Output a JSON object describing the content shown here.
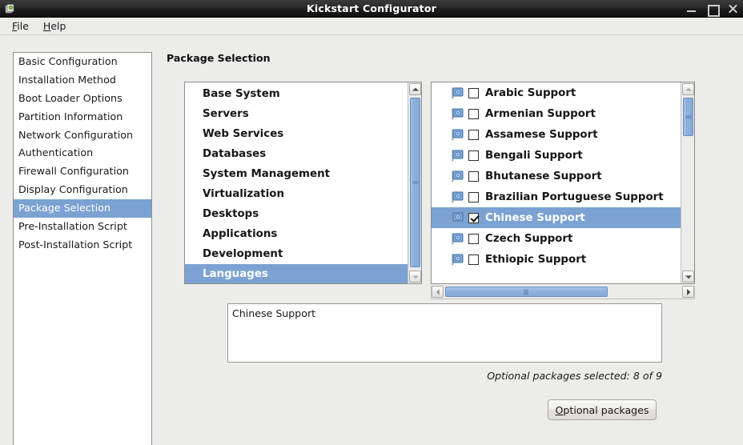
{
  "window": {
    "title": "Kickstart Configurator",
    "app_icon": "app-icon",
    "controls": {
      "minimize": "minimize",
      "maximize": "maximize",
      "close": "close"
    }
  },
  "menubar": {
    "items": [
      {
        "label": "File",
        "mnemonic": "F"
      },
      {
        "label": "Help",
        "mnemonic": "H"
      }
    ]
  },
  "sidebar": {
    "items": [
      {
        "label": "Basic Configuration",
        "selected": false
      },
      {
        "label": "Installation Method",
        "selected": false
      },
      {
        "label": "Boot Loader Options",
        "selected": false
      },
      {
        "label": "Partition Information",
        "selected": false
      },
      {
        "label": "Network Configuration",
        "selected": false
      },
      {
        "label": "Authentication",
        "selected": false
      },
      {
        "label": "Firewall Configuration",
        "selected": false
      },
      {
        "label": "Display Configuration",
        "selected": false
      },
      {
        "label": "Package Selection",
        "selected": true
      },
      {
        "label": "Pre-Installation Script",
        "selected": false
      },
      {
        "label": "Post-Installation Script",
        "selected": false
      }
    ]
  },
  "main": {
    "page_title": "Package Selection",
    "group_list": {
      "items": [
        {
          "label": "Base System",
          "selected": false
        },
        {
          "label": "Servers",
          "selected": false
        },
        {
          "label": "Web Services",
          "selected": false
        },
        {
          "label": "Databases",
          "selected": false
        },
        {
          "label": "System Management",
          "selected": false
        },
        {
          "label": "Virtualization",
          "selected": false
        },
        {
          "label": "Desktops",
          "selected": false
        },
        {
          "label": "Applications",
          "selected": false
        },
        {
          "label": "Development",
          "selected": false
        },
        {
          "label": "Languages",
          "selected": true
        }
      ]
    },
    "package_list": {
      "items": [
        {
          "label": "Arabic Support",
          "checked": false,
          "selected": false,
          "icon": "flag-icon"
        },
        {
          "label": "Armenian Support",
          "checked": false,
          "selected": false,
          "icon": "flag-icon"
        },
        {
          "label": "Assamese Support",
          "checked": false,
          "selected": false,
          "icon": "flag-icon"
        },
        {
          "label": "Bengali Support",
          "checked": false,
          "selected": false,
          "icon": "flag-icon"
        },
        {
          "label": "Bhutanese Support",
          "checked": false,
          "selected": false,
          "icon": "flag-icon"
        },
        {
          "label": "Brazilian Portuguese Support",
          "checked": false,
          "selected": false,
          "icon": "flag-icon"
        },
        {
          "label": "Chinese Support",
          "checked": true,
          "selected": true,
          "icon": "flag-icon"
        },
        {
          "label": "Czech Support",
          "checked": false,
          "selected": false,
          "icon": "flag-icon"
        },
        {
          "label": "Ethiopic Support",
          "checked": false,
          "selected": false,
          "icon": "flag-icon"
        }
      ]
    },
    "description": "Chinese Support",
    "optional_status": "Optional packages selected: 8 of 9",
    "optional_button": {
      "label": "Optional packages",
      "mnemonic": "O"
    }
  },
  "colors": {
    "selection_blue": "#7ba2d2",
    "window_bg": "#ececeb",
    "list_bg": "#ffffff",
    "titlebar_dark": "#1c1c1c",
    "scrollbar_thumb": "#8fb2dd"
  }
}
